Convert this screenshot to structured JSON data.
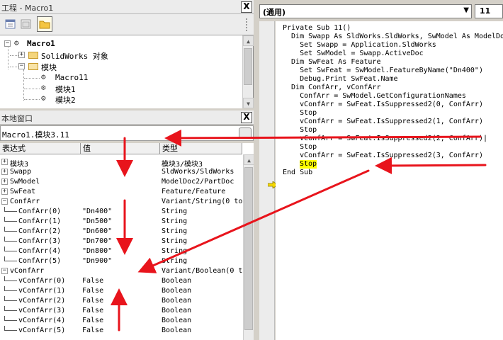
{
  "project_panel": {
    "title": "工程 - Macro1",
    "close_label": "X",
    "tree": {
      "root": "Macro1",
      "solidworks_node": "SolidWorks 对象",
      "modules_node": "模块",
      "modules": [
        "Macro11",
        "模块1",
        "模块2"
      ]
    }
  },
  "locals_panel": {
    "title": "本地窗口",
    "close_label": "X",
    "path": "Macro1.模块3.11",
    "path_button": "...",
    "columns": [
      "表达式",
      "值",
      "类型"
    ],
    "rows": [
      {
        "expander": "+",
        "name": "模块3",
        "value": "",
        "type": "模块3/模块3"
      },
      {
        "expander": "+",
        "name": "Swapp",
        "value": "",
        "type": "SldWorks/SldWorks"
      },
      {
        "expander": "+",
        "name": "SwModel",
        "value": "",
        "type": "ModelDoc2/PartDoc"
      },
      {
        "expander": "+",
        "name": "SwFeat",
        "value": "",
        "type": "Feature/Feature"
      },
      {
        "expander": "−",
        "name": "ConfArr",
        "value": "",
        "type": "Variant/String(0 to"
      },
      {
        "expander": "",
        "name": "ConfArr(0)",
        "value": "\"Dn400\"",
        "type": "String"
      },
      {
        "expander": "",
        "name": "ConfArr(1)",
        "value": "\"Dn500\"",
        "type": "String"
      },
      {
        "expander": "",
        "name": "ConfArr(2)",
        "value": "\"Dn600\"",
        "type": "String"
      },
      {
        "expander": "",
        "name": "ConfArr(3)",
        "value": "\"Dn700\"",
        "type": "String"
      },
      {
        "expander": "",
        "name": "ConfArr(4)",
        "value": "\"Dn800\"",
        "type": "String"
      },
      {
        "expander": "",
        "name": "ConfArr(5)",
        "value": "\"Dn900\"",
        "type": "String"
      },
      {
        "expander": "−",
        "name": "vConfArr",
        "value": "",
        "type": "Variant/Boolean(0 t"
      },
      {
        "expander": "",
        "name": "vConfArr(0)",
        "value": "False",
        "type": "Boolean"
      },
      {
        "expander": "",
        "name": "vConfArr(1)",
        "value": "False",
        "type": "Boolean"
      },
      {
        "expander": "",
        "name": "vConfArr(2)",
        "value": "False",
        "type": "Boolean"
      },
      {
        "expander": "",
        "name": "vConfArr(3)",
        "value": "False",
        "type": "Boolean"
      },
      {
        "expander": "",
        "name": "vConfArr(4)",
        "value": "False",
        "type": "Boolean"
      },
      {
        "expander": "",
        "name": "vConfArr(5)",
        "value": "False",
        "type": "Boolean"
      }
    ]
  },
  "code_window": {
    "object_combo": "(通用)",
    "proc_combo": "11",
    "lines": [
      "Private Sub 11()",
      "  Dim Swapp As SldWorks.SldWorks, SwModel As ModelDoc",
      "    Set Swapp = Application.SldWorks",
      "    Set SwModel = Swapp.ActiveDoc",
      "  Dim SwFeat As Feature",
      "    Set SwFeat = SwModel.FeatureByName(\"Dn400\")",
      "    Debug.Print SwFeat.Name",
      "  Dim ConfArr, vConfArr",
      "    ConfArr = SwModel.GetConfigurationNames",
      "    vConfArr = SwFeat.IsSuppressed2(0, ConfArr)",
      "    Stop",
      "    vConfArr = SwFeat.IsSuppressed2(1, ConfArr)",
      "    Stop",
      "    vConfArr = SwFeat.IsSuppressed2(2, ConfArr)|",
      "    Stop",
      "    vConfArr = SwFeat.IsSuppressed2(3, ConfArr)",
      "    ",
      "End Sub"
    ],
    "current_statement": "Stop"
  },
  "colors": {
    "annotation_arrow": "#e8141c",
    "highlight": "#ffff00",
    "execution_pointer": "#f5d800"
  }
}
